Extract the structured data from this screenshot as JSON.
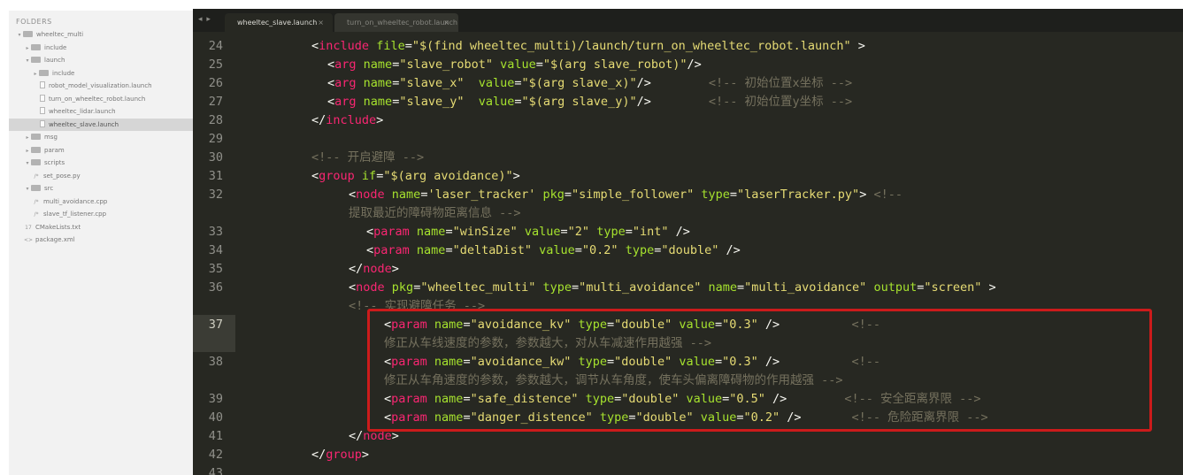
{
  "sidebar": {
    "title": "FOLDERS",
    "items": [
      {
        "label": "wheeltec_multi",
        "type": "folder",
        "depth": 0,
        "expanded": true
      },
      {
        "label": "include",
        "type": "folder",
        "depth": 1,
        "expanded": false
      },
      {
        "label": "launch",
        "type": "folder",
        "depth": 1,
        "expanded": true
      },
      {
        "label": "include",
        "type": "folder",
        "depth": 2,
        "expanded": false
      },
      {
        "label": "robot_model_visualization.launch",
        "type": "file",
        "depth": 3
      },
      {
        "label": "turn_on_wheeltec_robot.launch",
        "type": "file",
        "depth": 3
      },
      {
        "label": "wheeltec_lidar.launch",
        "type": "file",
        "depth": 3
      },
      {
        "label": "wheeltec_slave.launch",
        "type": "file",
        "depth": 3,
        "selected": true
      },
      {
        "label": "msg",
        "type": "folder",
        "depth": 1,
        "expanded": false
      },
      {
        "label": "param",
        "type": "folder",
        "depth": 1,
        "expanded": false
      },
      {
        "label": "scripts",
        "type": "folder",
        "depth": 1,
        "expanded": true
      },
      {
        "label": "set_pose.py",
        "type": "file",
        "depth": 2,
        "ext": "/*"
      },
      {
        "label": "src",
        "type": "folder",
        "depth": 1,
        "expanded": true
      },
      {
        "label": "multi_avoidance.cpp",
        "type": "file",
        "depth": 2,
        "ext": "/*"
      },
      {
        "label": "slave_tf_listener.cpp",
        "type": "file",
        "depth": 2,
        "ext": "/*"
      },
      {
        "label": "CMakeLists.txt",
        "type": "file",
        "depth": 1,
        "ext": "17"
      },
      {
        "label": "package.xml",
        "type": "file",
        "depth": 1,
        "ext": "<>"
      }
    ]
  },
  "tabs": {
    "nav": "◂ ▸",
    "active": {
      "label": "wheeltec_slave.launch",
      "close": "×"
    },
    "inactive": {
      "label": "turn_on_wheeltec_robot.launch",
      "close": "×"
    }
  },
  "editor": {
    "lines": [
      {
        "num": "24",
        "parts": [
          [
            "p",
            "<"
          ],
          [
            "t",
            "include"
          ],
          [
            "p",
            " "
          ],
          [
            "a",
            "file"
          ],
          [
            "p",
            "="
          ],
          [
            "s",
            "\"$(find wheeltec_multi)/launch/turn_on_wheeltec_robot.launch\""
          ],
          [
            "p",
            " >"
          ]
        ]
      },
      {
        "num": "25",
        "parts": [
          [
            "p",
            "<"
          ],
          [
            "t",
            "arg"
          ],
          [
            "p",
            " "
          ],
          [
            "a",
            "name"
          ],
          [
            "p",
            "="
          ],
          [
            "s",
            "\"slave_robot\""
          ],
          [
            "p",
            " "
          ],
          [
            "a",
            "value"
          ],
          [
            "p",
            "="
          ],
          [
            "s",
            "\"$(arg slave_robot)\""
          ],
          [
            "p",
            "/>"
          ]
        ]
      },
      {
        "num": "26",
        "parts": [
          [
            "p",
            "<"
          ],
          [
            "t",
            "arg"
          ],
          [
            "p",
            " "
          ],
          [
            "a",
            "name"
          ],
          [
            "p",
            "="
          ],
          [
            "s",
            "\"slave_x\""
          ],
          [
            "p",
            "  "
          ],
          [
            "a",
            "value"
          ],
          [
            "p",
            "="
          ],
          [
            "s",
            "\"$(arg slave_x)\""
          ],
          [
            "p",
            "/>"
          ],
          [
            "p",
            "        "
          ],
          [
            "c",
            "<!-- 初始位置x坐标 -->"
          ]
        ]
      },
      {
        "num": "27",
        "parts": [
          [
            "p",
            "<"
          ],
          [
            "t",
            "arg"
          ],
          [
            "p",
            " "
          ],
          [
            "a",
            "name"
          ],
          [
            "p",
            "="
          ],
          [
            "s",
            "\"slave_y\""
          ],
          [
            "p",
            "  "
          ],
          [
            "a",
            "value"
          ],
          [
            "p",
            "="
          ],
          [
            "s",
            "\"$(arg slave_y)\""
          ],
          [
            "p",
            "/>"
          ],
          [
            "p",
            "        "
          ],
          [
            "c",
            "<!-- 初始位置y坐标 -->"
          ]
        ]
      },
      {
        "num": "28",
        "parts": [
          [
            "p",
            "</"
          ],
          [
            "t",
            "include"
          ],
          [
            "p",
            ">"
          ]
        ]
      },
      {
        "num": "29",
        "parts": []
      },
      {
        "num": "30",
        "parts": [
          [
            "c",
            "<!-- 开启避障 -->"
          ]
        ]
      },
      {
        "num": "31",
        "parts": [
          [
            "p",
            "<"
          ],
          [
            "t",
            "group"
          ],
          [
            "p",
            " "
          ],
          [
            "a",
            "if"
          ],
          [
            "p",
            "="
          ],
          [
            "s",
            "\"$(arg avoidance)\""
          ],
          [
            "p",
            ">"
          ]
        ]
      },
      {
        "num": "32",
        "parts": [
          [
            "p",
            "<"
          ],
          [
            "t",
            "node"
          ],
          [
            "p",
            " "
          ],
          [
            "a",
            "name"
          ],
          [
            "p",
            "="
          ],
          [
            "s",
            "'laser_tracker'"
          ],
          [
            "p",
            " "
          ],
          [
            "a",
            "pkg"
          ],
          [
            "p",
            "="
          ],
          [
            "s",
            "\"simple_follower\""
          ],
          [
            "p",
            " "
          ],
          [
            "a",
            "type"
          ],
          [
            "p",
            "="
          ],
          [
            "s",
            "\"laserTracker.py\""
          ],
          [
            "p",
            "> "
          ],
          [
            "c",
            "<!--"
          ]
        ]
      },
      {
        "num": "",
        "parts": [
          [
            "c",
            "提取最近的障碍物距离信息 -->"
          ]
        ]
      },
      {
        "num": "33",
        "parts": [
          [
            "p",
            "<"
          ],
          [
            "t",
            "param"
          ],
          [
            "p",
            " "
          ],
          [
            "a",
            "name"
          ],
          [
            "p",
            "="
          ],
          [
            "s",
            "\"winSize\""
          ],
          [
            "p",
            " "
          ],
          [
            "a",
            "value"
          ],
          [
            "p",
            "="
          ],
          [
            "s",
            "\"2\""
          ],
          [
            "p",
            " "
          ],
          [
            "a",
            "type"
          ],
          [
            "p",
            "="
          ],
          [
            "s",
            "\"int\""
          ],
          [
            "p",
            " />"
          ]
        ]
      },
      {
        "num": "34",
        "parts": [
          [
            "p",
            "<"
          ],
          [
            "t",
            "param"
          ],
          [
            "p",
            " "
          ],
          [
            "a",
            "name"
          ],
          [
            "p",
            "="
          ],
          [
            "s",
            "\"deltaDist\""
          ],
          [
            "p",
            " "
          ],
          [
            "a",
            "value"
          ],
          [
            "p",
            "="
          ],
          [
            "s",
            "\"0.2\""
          ],
          [
            "p",
            " "
          ],
          [
            "a",
            "type"
          ],
          [
            "p",
            "="
          ],
          [
            "s",
            "\"double\""
          ],
          [
            "p",
            " />"
          ]
        ]
      },
      {
        "num": "35",
        "parts": [
          [
            "p",
            "</"
          ],
          [
            "t",
            "node"
          ],
          [
            "p",
            ">"
          ]
        ]
      },
      {
        "num": "36",
        "parts": [
          [
            "p",
            "<"
          ],
          [
            "t",
            "node"
          ],
          [
            "p",
            " "
          ],
          [
            "a",
            "pkg"
          ],
          [
            "p",
            "="
          ],
          [
            "s",
            "\"wheeltec_multi\""
          ],
          [
            "p",
            " "
          ],
          [
            "a",
            "type"
          ],
          [
            "p",
            "="
          ],
          [
            "s",
            "\"multi_avoidance\""
          ],
          [
            "p",
            " "
          ],
          [
            "a",
            "name"
          ],
          [
            "p",
            "="
          ],
          [
            "s",
            "\"multi_avoidance\""
          ],
          [
            "p",
            " "
          ],
          [
            "a",
            "output"
          ],
          [
            "p",
            "="
          ],
          [
            "s",
            "\"screen\""
          ],
          [
            "p",
            " >"
          ]
        ]
      },
      {
        "num": "",
        "parts": [
          [
            "c",
            "<!-- 实现避障任务 -->"
          ]
        ]
      },
      {
        "num": "37",
        "parts": [
          [
            "p",
            "<"
          ],
          [
            "t",
            "param"
          ],
          [
            "p",
            " "
          ],
          [
            "a",
            "name"
          ],
          [
            "p",
            "="
          ],
          [
            "s",
            "\"avoidance_kv\""
          ],
          [
            "p",
            " "
          ],
          [
            "a",
            "type"
          ],
          [
            "p",
            "="
          ],
          [
            "s",
            "\"double\""
          ],
          [
            "p",
            " "
          ],
          [
            "a",
            "value"
          ],
          [
            "p",
            "="
          ],
          [
            "s",
            "\"0.3\""
          ],
          [
            "p",
            " />"
          ],
          [
            "p",
            "          "
          ],
          [
            "c",
            "<!--"
          ]
        ]
      },
      {
        "num": "",
        "parts": [
          [
            "c",
            "修正从车线速度的参数，参数越大，对从车减速作用越强 -->"
          ]
        ]
      },
      {
        "num": "38",
        "parts": [
          [
            "p",
            "<"
          ],
          [
            "t",
            "param"
          ],
          [
            "p",
            " "
          ],
          [
            "a",
            "name"
          ],
          [
            "p",
            "="
          ],
          [
            "s",
            "\"avoidance_kw\""
          ],
          [
            "p",
            " "
          ],
          [
            "a",
            "type"
          ],
          [
            "p",
            "="
          ],
          [
            "s",
            "\"double\""
          ],
          [
            "p",
            " "
          ],
          [
            "a",
            "value"
          ],
          [
            "p",
            "="
          ],
          [
            "s",
            "\"0.3\""
          ],
          [
            "p",
            " />"
          ],
          [
            "p",
            "          "
          ],
          [
            "c",
            "<!--"
          ]
        ]
      },
      {
        "num": "",
        "parts": [
          [
            "c",
            "修正从车角速度的参数，参数越大，调节从车角度，使车头偏离障碍物的作用越强 -->"
          ]
        ]
      },
      {
        "num": "39",
        "parts": [
          [
            "p",
            "<"
          ],
          [
            "t",
            "param"
          ],
          [
            "p",
            " "
          ],
          [
            "a",
            "name"
          ],
          [
            "p",
            "="
          ],
          [
            "s",
            "\"safe_distence\""
          ],
          [
            "p",
            " "
          ],
          [
            "a",
            "type"
          ],
          [
            "p",
            "="
          ],
          [
            "s",
            "\"double\""
          ],
          [
            "p",
            " "
          ],
          [
            "a",
            "value"
          ],
          [
            "p",
            "="
          ],
          [
            "s",
            "\"0.5\""
          ],
          [
            "p",
            " />"
          ],
          [
            "p",
            "        "
          ],
          [
            "c",
            "<!-- 安全距离界限 -->"
          ]
        ]
      },
      {
        "num": "40",
        "parts": [
          [
            "p",
            "<"
          ],
          [
            "t",
            "param"
          ],
          [
            "p",
            " "
          ],
          [
            "a",
            "name"
          ],
          [
            "p",
            "="
          ],
          [
            "s",
            "\"danger_distence\""
          ],
          [
            "p",
            " "
          ],
          [
            "a",
            "type"
          ],
          [
            "p",
            "="
          ],
          [
            "s",
            "\"double\""
          ],
          [
            "p",
            " "
          ],
          [
            "a",
            "value"
          ],
          [
            "p",
            "="
          ],
          [
            "s",
            "\"0.2\""
          ],
          [
            "p",
            " />"
          ],
          [
            "p",
            "       "
          ],
          [
            "c",
            "<!-- 危险距离界限 -->"
          ]
        ]
      },
      {
        "num": "41",
        "parts": [
          [
            "p",
            "</"
          ],
          [
            "t",
            "node"
          ],
          [
            "p",
            ">"
          ]
        ]
      },
      {
        "num": "42",
        "parts": [
          [
            "p",
            "</"
          ],
          [
            "t",
            "group"
          ],
          [
            "p",
            ">"
          ]
        ]
      },
      {
        "num": "43",
        "parts": []
      }
    ]
  },
  "colors": {
    "editor_bg": "#272822",
    "tag": "#f92672",
    "attribute": "#a6e22e",
    "string": "#e6db74",
    "comment": "#75715e",
    "highlight_box": "#cc1b1b"
  }
}
